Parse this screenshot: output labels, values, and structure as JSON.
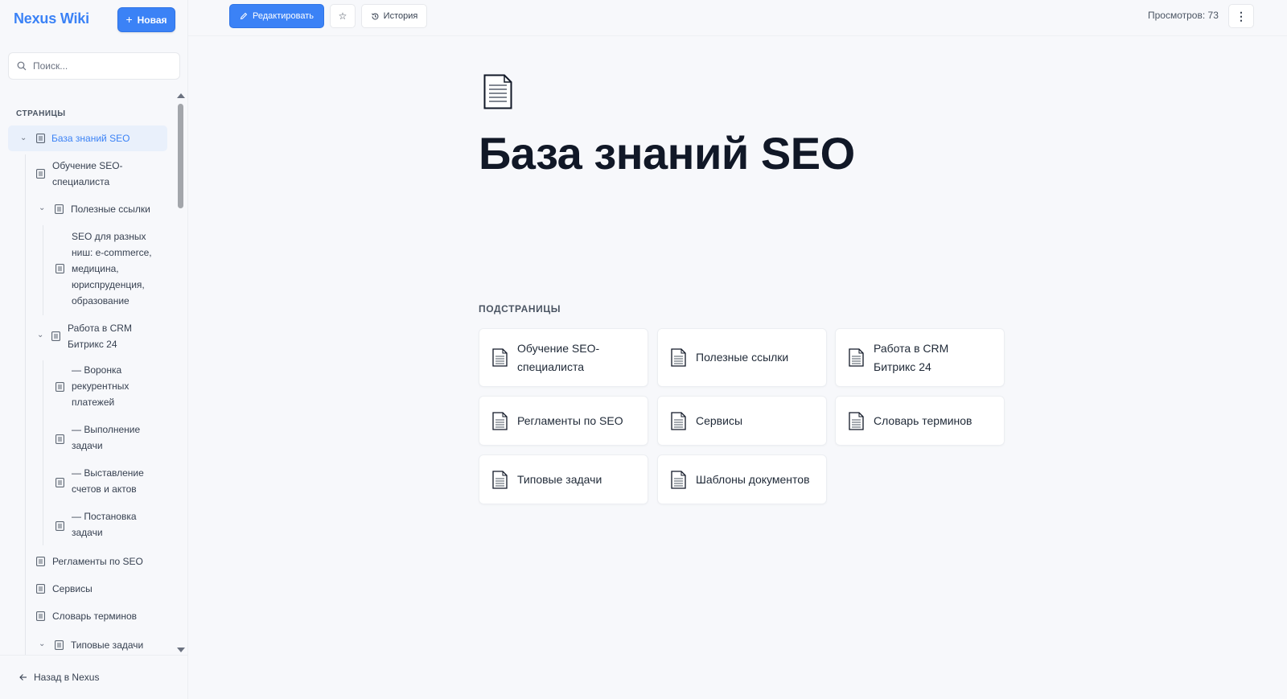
{
  "sidebar": {
    "brand": "Nexus Wiki",
    "new_button": "Новая",
    "search_placeholder": "Поиск...",
    "section_label": "СТРАНИЦЫ",
    "tree": [
      {
        "label": "База знаний SEO"
      },
      {
        "label": "Обучение SEO-специалиста"
      },
      {
        "label": "Полезные ссылки"
      },
      {
        "label": "SEO для разных ниш: e-commerce, медицина, юриспруденция, образование"
      },
      {
        "label": "Работа в CRM Битрикс 24"
      },
      {
        "label": "— Воронка рекурентных платежей"
      },
      {
        "label": "— Выполнение задачи"
      },
      {
        "label": "— Выставление счетов и актов"
      },
      {
        "label": "— Постановка задачи"
      },
      {
        "label": "Регламенты по SEO"
      },
      {
        "label": "Сервисы"
      },
      {
        "label": "Словарь терминов"
      },
      {
        "label": "Типовые задачи"
      }
    ],
    "back_link": "Назад в Nexus"
  },
  "toolbar": {
    "edit_label": "Редактировать",
    "history_label": "История",
    "views_text": "Просмотров: 73"
  },
  "page": {
    "title": "База знаний SEO",
    "subpages_label": "ПОДСТРАНИЦЫ",
    "subpages": [
      {
        "label": "Обучение SEO-специалиста"
      },
      {
        "label": "Полезные ссылки"
      },
      {
        "label": "Работа в CRM Битрикс 24"
      },
      {
        "label": "Регламенты по SEO"
      },
      {
        "label": "Сервисы"
      },
      {
        "label": "Словарь терминов"
      },
      {
        "label": "Типовые задачи"
      },
      {
        "label": "Шаблоны документов"
      }
    ]
  },
  "colors": {
    "accent": "#3b82f6",
    "background": "#f7f8fb",
    "active_bg": "#e9f0fb"
  },
  "icons": [
    "search-icon",
    "plus-icon",
    "pencil-icon",
    "star-icon",
    "history-icon",
    "more-vertical-icon",
    "chevron-down-icon",
    "document-icon",
    "arrow-left-icon"
  ]
}
